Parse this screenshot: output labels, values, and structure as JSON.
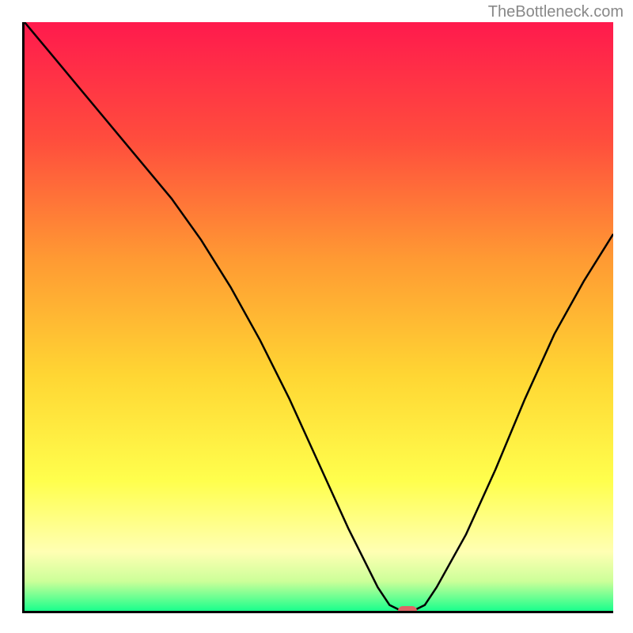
{
  "watermark": "TheBottleneck.com",
  "chart_data": {
    "type": "line",
    "title": "",
    "xlabel": "",
    "ylabel": "",
    "xlim": [
      0,
      100
    ],
    "ylim": [
      0,
      100
    ],
    "x": [
      0,
      5,
      10,
      15,
      20,
      25,
      30,
      35,
      40,
      45,
      50,
      55,
      60,
      62,
      64,
      66,
      68,
      70,
      75,
      80,
      85,
      90,
      95,
      100
    ],
    "y": [
      100,
      94,
      88,
      82,
      76,
      70,
      63,
      55,
      46,
      36,
      25,
      14,
      4,
      1,
      0,
      0,
      1,
      4,
      13,
      24,
      36,
      47,
      56,
      64
    ],
    "marker": {
      "x": 65,
      "y": 0
    },
    "gradient_stops": [
      {
        "pct": 0,
        "color": "#ff1a4d"
      },
      {
        "pct": 20,
        "color": "#ff4d3d"
      },
      {
        "pct": 40,
        "color": "#ff9933"
      },
      {
        "pct": 60,
        "color": "#ffd633"
      },
      {
        "pct": 78,
        "color": "#ffff4d"
      },
      {
        "pct": 90,
        "color": "#ffffb3"
      },
      {
        "pct": 95,
        "color": "#ccff99"
      },
      {
        "pct": 100,
        "color": "#1aff8c"
      }
    ]
  }
}
